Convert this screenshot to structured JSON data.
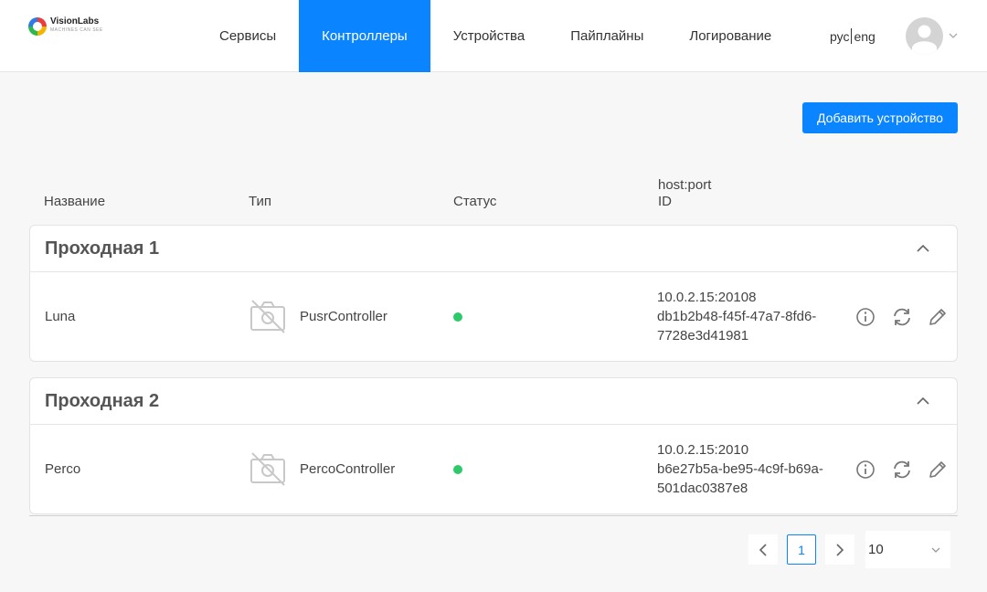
{
  "brand": {
    "name": "VisionLabs",
    "tagline": "MACHINES CAN SEE"
  },
  "nav": {
    "items": [
      {
        "label": "Сервисы"
      },
      {
        "label": "Контроллеры"
      },
      {
        "label": "Устройства"
      },
      {
        "label": "Пайплайны"
      },
      {
        "label": "Логирование"
      }
    ],
    "active": "Контроллеры"
  },
  "lang": {
    "ru": "рус",
    "en": "eng"
  },
  "actions": {
    "add_device": "Добавить устройство"
  },
  "table": {
    "columns": {
      "name": "Название",
      "type": "Тип",
      "status": "Статус",
      "host": "host:port",
      "id": "ID"
    }
  },
  "groups": [
    {
      "title": "Проходная 1",
      "row": {
        "name": "Luna",
        "type": "PusrController",
        "status": "online",
        "host": "10.0.2.15:20108",
        "id": "db1b2b48-f45f-47a7-8fd6-7728e3d41981"
      }
    },
    {
      "title": "Проходная 2",
      "row": {
        "name": "Perco",
        "type": "PercoController",
        "status": "online",
        "host": "10.0.2.15:2010",
        "id": "b6e27b5a-be95-4c9f-b69a-501dac0387e8"
      }
    }
  ],
  "pagination": {
    "current_page": "1",
    "per_page": "10"
  },
  "colors": {
    "accent": "#0a84ff",
    "status_online": "#2ec96a"
  }
}
